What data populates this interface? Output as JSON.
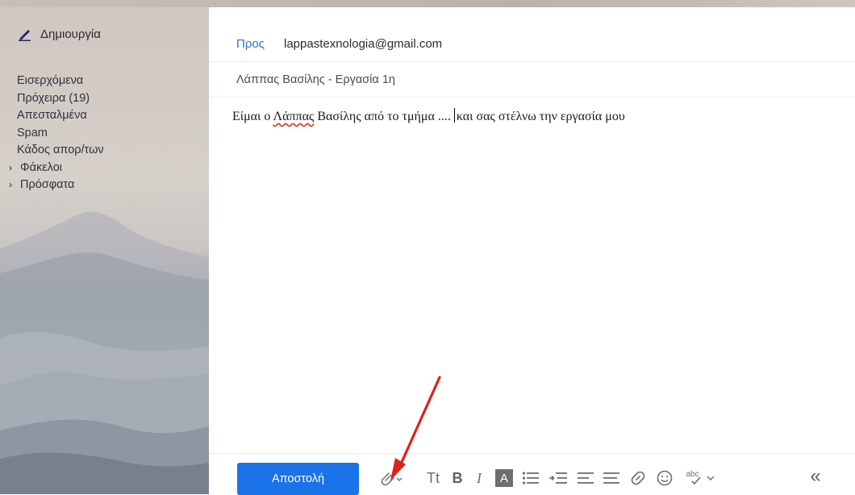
{
  "sidebar": {
    "compose_label": "Δημιουργία",
    "items": [
      {
        "label": "Εισερχόμενα"
      },
      {
        "label": "Πρόχειρα (19)"
      },
      {
        "label": "Απεσταλμένα"
      },
      {
        "label": "Spam"
      },
      {
        "label": "Κάδος απορ/των"
      }
    ],
    "groups": [
      {
        "label": "Φάκελοι"
      },
      {
        "label": "Πρόσφατα"
      }
    ]
  },
  "compose": {
    "to_label": "Προς",
    "to_value": "lappastexnologia@gmail.com",
    "subject": "Λάππας Βασίλης - Εργασία 1η",
    "body_before": "Είμαι ο ",
    "body_misspelled": "Λάππας",
    "body_middle": " Βασίλης από το τμήμα ....",
    "body_after": "και σας στέλνω την εργασία μου"
  },
  "toolbar": {
    "send_label": "Αποστολή",
    "font_size_glyph": "Tt",
    "bold_glyph": "B",
    "italic_glyph": "I",
    "text_color_glyph": "A",
    "spellcheck_glyph": "abc",
    "collapse_glyph": "«"
  },
  "colors": {
    "accent": "#1a73e8",
    "link": "#2a72c8",
    "annotation_arrow": "#e0221a"
  }
}
